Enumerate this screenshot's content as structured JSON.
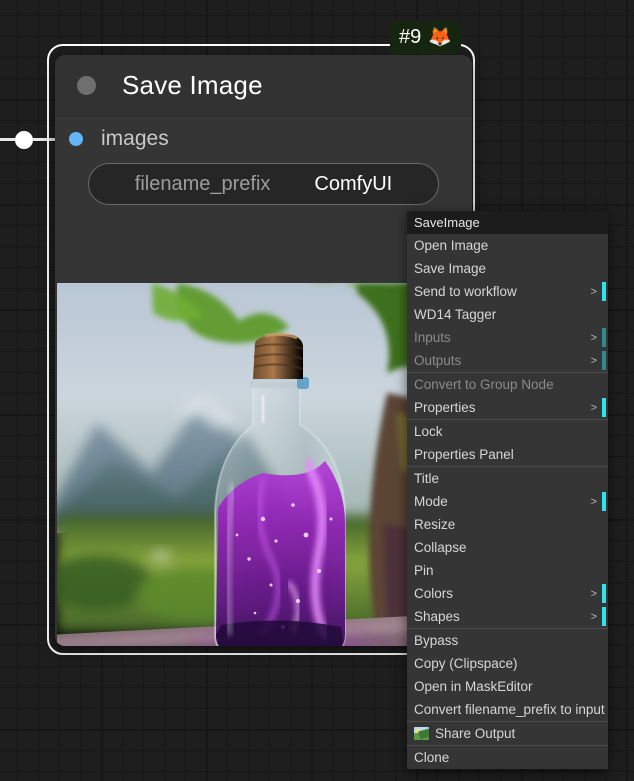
{
  "canvas": {
    "background_color": "#1e1e1e",
    "grid_color": "#171717"
  },
  "node": {
    "badge": {
      "id_label": "#9",
      "emoji": "🦊",
      "emoji_name": "fox-face",
      "bg_color": "#16250f"
    },
    "title": "Save Image",
    "collapse_dot_name": "collapse-dot",
    "inputs": [
      {
        "label": "images",
        "dot_color": "#64b5f6"
      }
    ],
    "widgets": [
      {
        "name": "filename_prefix",
        "value": "ComfyUI"
      }
    ],
    "preview": {
      "alt": "Magical purple glowing potion in a corked glass bottle resting on a stone ledge, blurred green mountains and fields behind"
    }
  },
  "context_menu": {
    "header": "SaveImage",
    "groups": [
      {
        "items": [
          {
            "label": "Open Image",
            "submenu": false,
            "disabled": false
          },
          {
            "label": "Save Image",
            "submenu": false,
            "disabled": false
          },
          {
            "label": "Send to workflow",
            "submenu": true,
            "disabled": false
          },
          {
            "label": "WD14 Tagger",
            "submenu": false,
            "disabled": false
          },
          {
            "label": "Inputs",
            "submenu": true,
            "disabled": true
          },
          {
            "label": "Outputs",
            "submenu": true,
            "disabled": true
          }
        ]
      },
      {
        "items": [
          {
            "label": "Convert to Group Node",
            "submenu": false,
            "disabled": true
          },
          {
            "label": "Properties",
            "submenu": true,
            "disabled": false
          }
        ]
      },
      {
        "items": [
          {
            "label": "Lock",
            "submenu": false,
            "disabled": false
          },
          {
            "label": "Properties Panel",
            "submenu": false,
            "disabled": false
          }
        ]
      },
      {
        "items": [
          {
            "label": "Title",
            "submenu": false,
            "disabled": false
          },
          {
            "label": "Mode",
            "submenu": true,
            "disabled": false
          },
          {
            "label": "Resize",
            "submenu": false,
            "disabled": false
          },
          {
            "label": "Collapse",
            "submenu": false,
            "disabled": false
          },
          {
            "label": "Pin",
            "submenu": false,
            "disabled": false
          },
          {
            "label": "Colors",
            "submenu": true,
            "disabled": false
          },
          {
            "label": "Shapes",
            "submenu": true,
            "disabled": false
          }
        ]
      },
      {
        "items": [
          {
            "label": "Bypass",
            "submenu": false,
            "disabled": false
          },
          {
            "label": "Copy (Clipspace)",
            "submenu": false,
            "disabled": false
          },
          {
            "label": "Open in MaskEditor",
            "submenu": false,
            "disabled": false
          },
          {
            "label": "Convert filename_prefix to input",
            "submenu": false,
            "disabled": false
          }
        ]
      },
      {
        "items": [
          {
            "label": "Share Output",
            "submenu": false,
            "disabled": false,
            "icon": "picture-icon"
          }
        ]
      },
      {
        "items": [
          {
            "label": "Clone",
            "submenu": false,
            "disabled": false
          }
        ]
      }
    ],
    "submenu_arrow": ">",
    "accent_color": "#2fe3ec"
  }
}
